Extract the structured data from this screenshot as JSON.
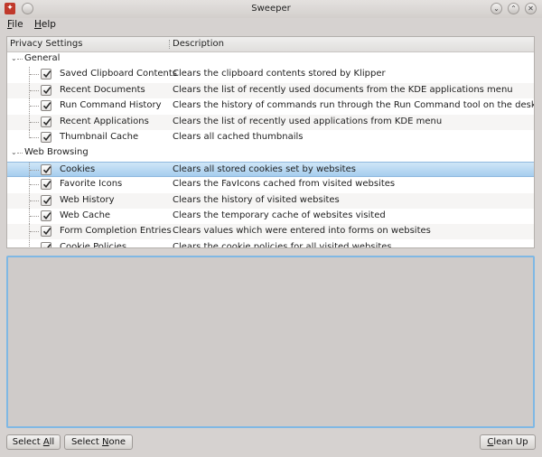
{
  "window": {
    "title": "Sweeper",
    "app_icon": "sweeper-app-icon"
  },
  "menu": {
    "file": {
      "pre": "",
      "accel": "F",
      "post": "ile"
    },
    "help": {
      "pre": "",
      "accel": "H",
      "post": "elp"
    }
  },
  "tree": {
    "columns": [
      "Privacy Settings",
      "Description"
    ],
    "groups": [
      {
        "label": "General",
        "items": [
          {
            "label": "Saved Clipboard Contents",
            "desc": "Clears the clipboard contents stored by Klipper",
            "checked": true
          },
          {
            "label": "Recent Documents",
            "desc": "Clears the list of recently used documents from the KDE applications menu",
            "checked": true
          },
          {
            "label": "Run Command History",
            "desc": "Clears the history of commands run through the Run Command tool on the desktop",
            "checked": true
          },
          {
            "label": "Recent Applications",
            "desc": "Clears the list of recently used applications from KDE menu",
            "checked": true
          },
          {
            "label": "Thumbnail Cache",
            "desc": "Clears all cached thumbnails",
            "checked": true
          }
        ]
      },
      {
        "label": "Web Browsing",
        "items": [
          {
            "label": "Cookies",
            "desc": "Clears all stored cookies set by websites",
            "checked": true,
            "selected": true
          },
          {
            "label": "Favorite Icons",
            "desc": "Clears the FavIcons cached from visited websites",
            "checked": true
          },
          {
            "label": "Web History",
            "desc": "Clears the history of visited websites",
            "checked": true
          },
          {
            "label": "Web Cache",
            "desc": "Clears the temporary cache of websites visited",
            "checked": true
          },
          {
            "label": "Form Completion Entries",
            "desc": "Clears values which were entered into forms on websites",
            "checked": true
          },
          {
            "label": "Cookie Policies",
            "desc": "Clears the cookie policies for all visited websites",
            "checked": true
          }
        ]
      }
    ]
  },
  "buttons": {
    "select_all": {
      "pre": "Select ",
      "accel": "A",
      "post": "ll"
    },
    "select_none": {
      "pre": "Select ",
      "accel": "N",
      "post": "one"
    },
    "clean_up": {
      "pre": "",
      "accel": "C",
      "post": "lean Up"
    }
  },
  "colors": {
    "selection": "#a6cdee",
    "output_border": "#7fb8e4",
    "app_icon": "#c0392b"
  }
}
